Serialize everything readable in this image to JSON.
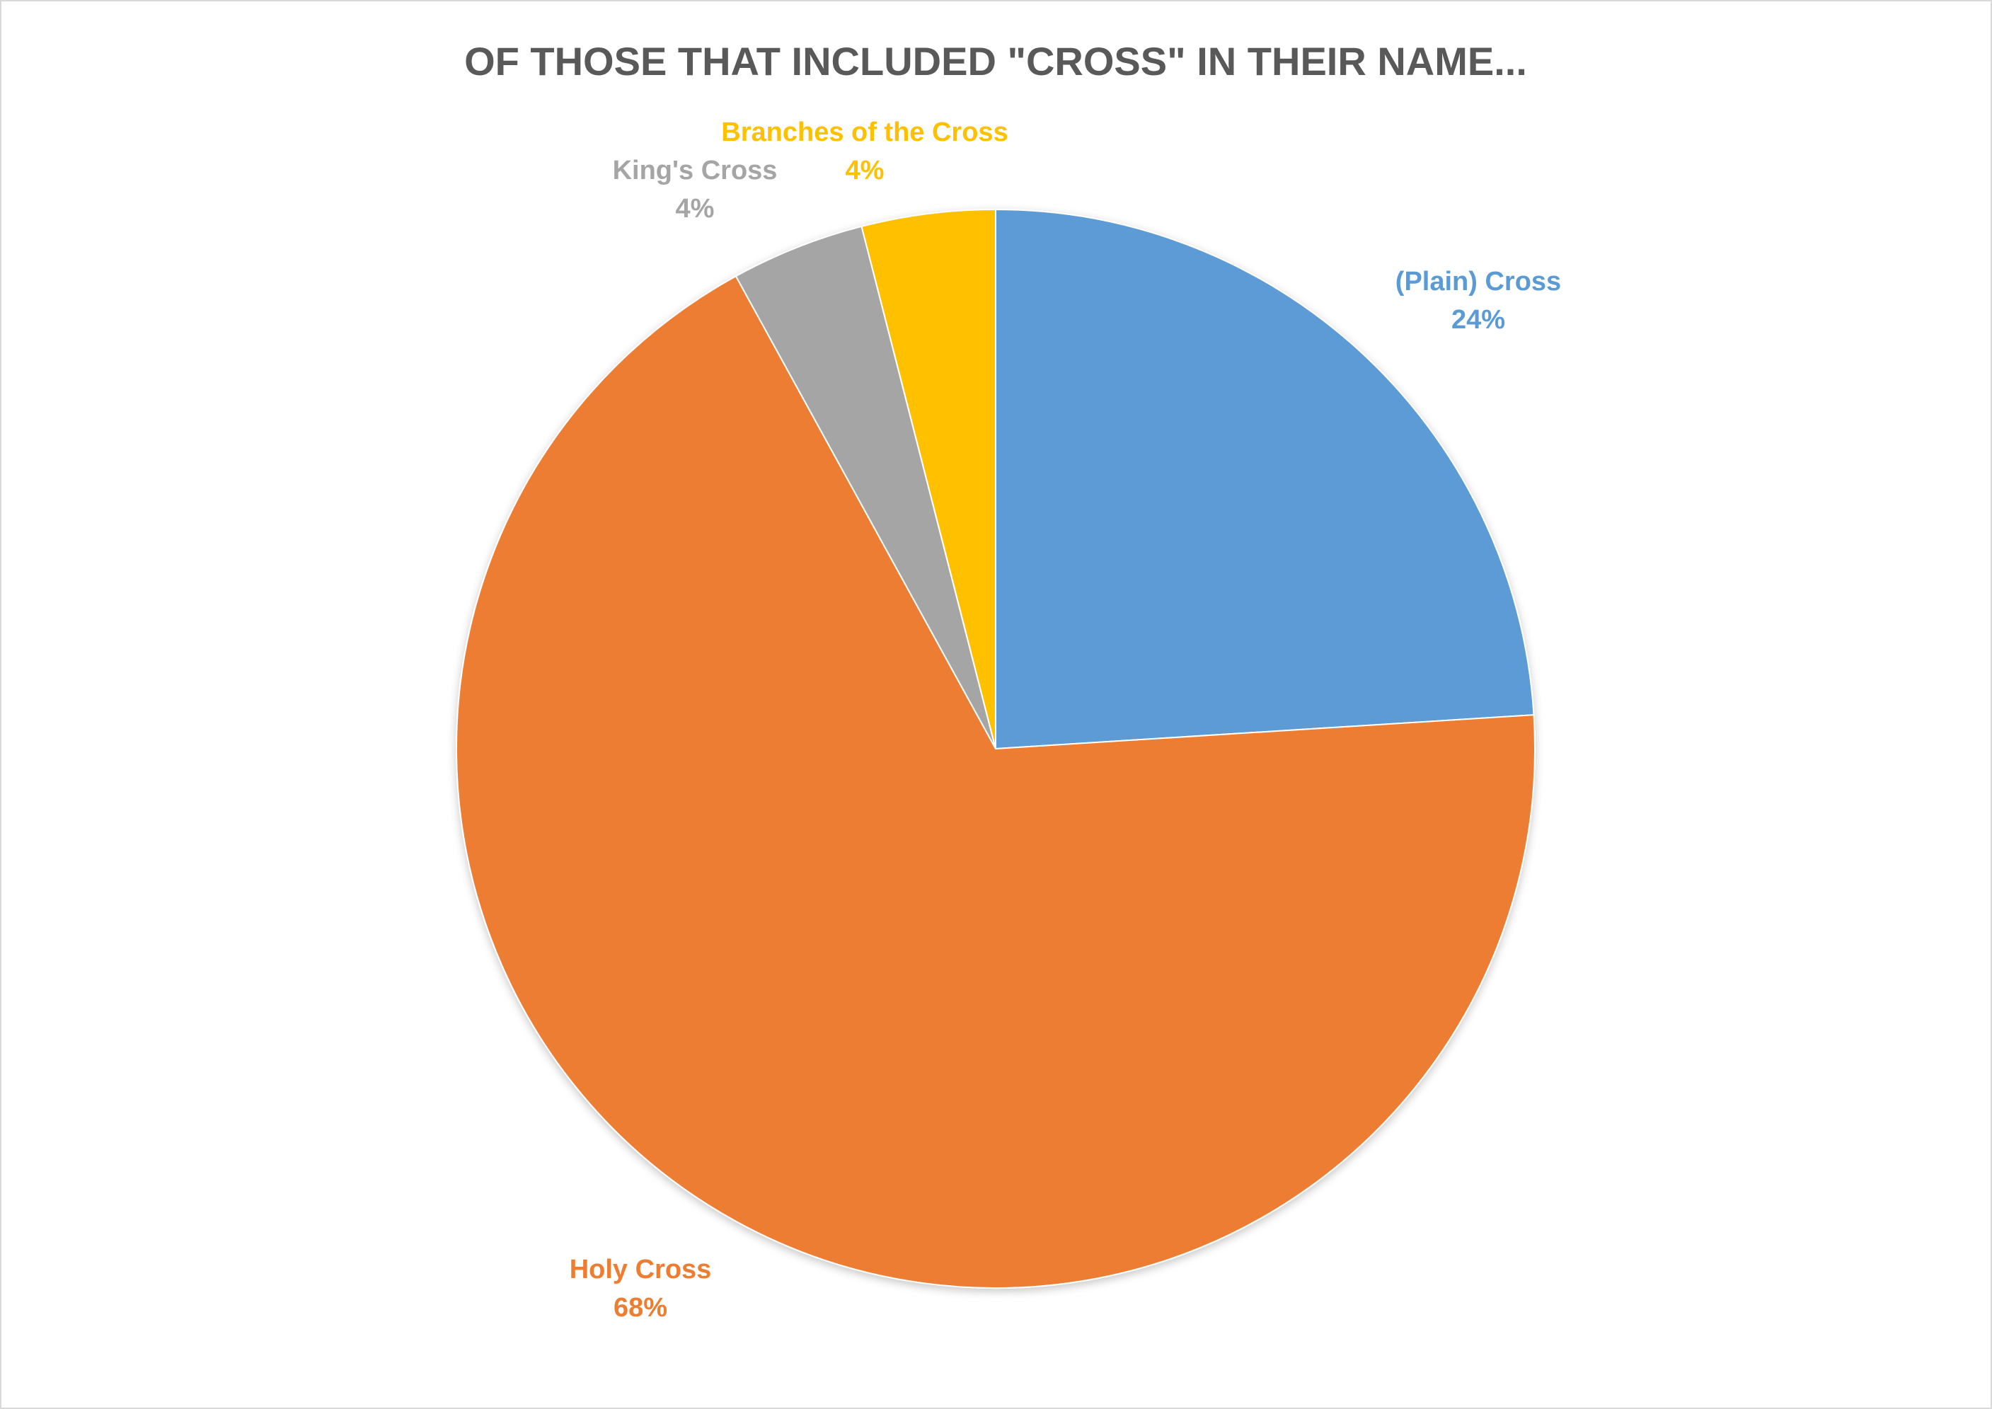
{
  "chart_data": {
    "type": "pie",
    "title": "OF THOSE THAT INCLUDED \"CROSS\" IN THEIR NAME...",
    "slices": [
      {
        "label": "(Plain) Cross",
        "value": 24,
        "value_label": "24%",
        "color": "#5b9bd5"
      },
      {
        "label": "Holy Cross",
        "value": 68,
        "value_label": "68%",
        "color": "#ed7d31"
      },
      {
        "label": "King's Cross",
        "value": 4,
        "value_label": "4%",
        "color": "#a5a5a5"
      },
      {
        "label": "Branches of the Cross",
        "value": 4,
        "value_label": "4%",
        "color": "#ffc000"
      }
    ],
    "start_angle": "12 o'clock",
    "direction": "clockwise",
    "legend": "none",
    "data_labels": "category name and percentage"
  }
}
